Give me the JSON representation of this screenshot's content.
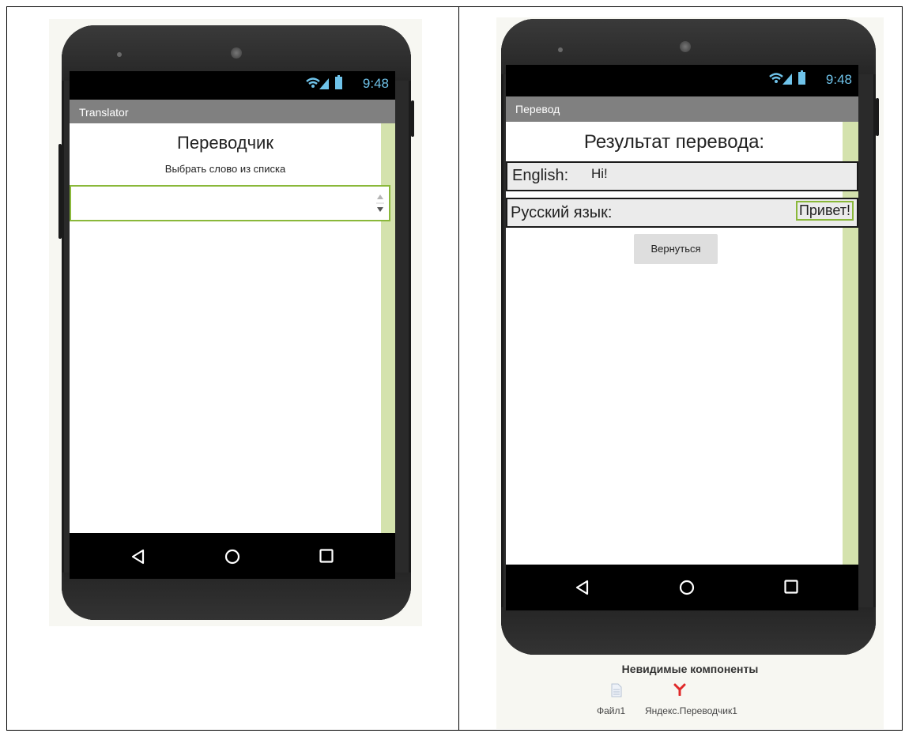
{
  "left_phone": {
    "status_time": "9:48",
    "title_bar": "Translator",
    "heading": "Переводчик",
    "subheading": "Выбрать слово из списка",
    "list_picker_value": ""
  },
  "right_phone": {
    "status_time": "9:48",
    "title_bar": "Перевод",
    "heading": "Результат перевода:",
    "english_label": "English:",
    "english_value": "Hi!",
    "russian_label": "Русский язык:",
    "russian_value": "Привет!",
    "back_button": "Вернуться"
  },
  "invisible_components": {
    "title": "Невидимые компоненты",
    "items": [
      {
        "label": "Файл1",
        "icon": "file-icon"
      },
      {
        "label": "Яндекс.Переводчик1",
        "icon": "yandex-icon"
      }
    ]
  },
  "colors": {
    "status_text": "#6fc3ea",
    "title_bar": "#808080",
    "scroll_track": "#d4e2ad",
    "field_border_green": "#8ab83a"
  }
}
